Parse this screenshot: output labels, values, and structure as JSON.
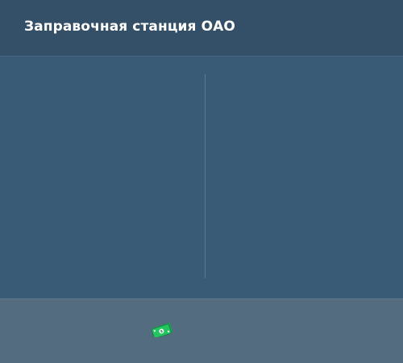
{
  "header": {
    "title": "Заправочная станция ОАО"
  },
  "footer": {
    "icon": "money-icon",
    "icon_color": "#22c55e"
  },
  "colors": {
    "header_bg": "#344f68",
    "content_bg": "#3a5b75",
    "footer_bg": "#536c80",
    "title_text": "#ffffff"
  }
}
